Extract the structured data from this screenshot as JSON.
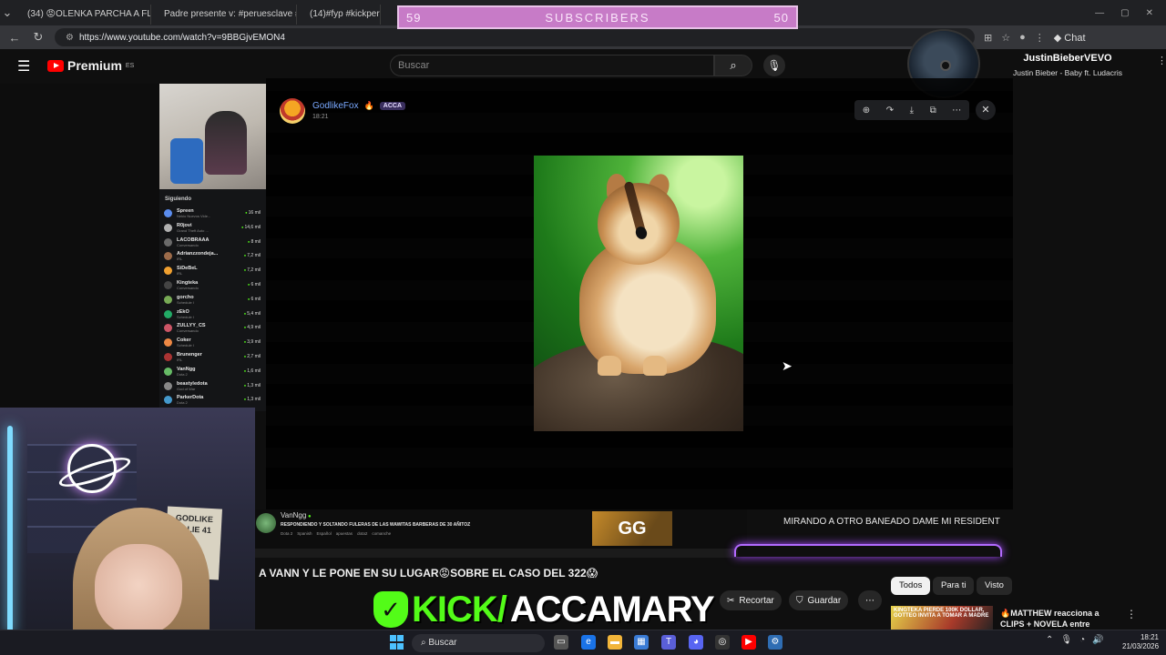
{
  "browser": {
    "tabs": [
      {
        "label": "(34) 😡OLENKA PARCHA A FLAPA",
        "color": "#e53935"
      },
      {
        "label": "Padre presente v: #peruesclave #c",
        "color": "#ffffff"
      },
      {
        "label": "(14)#fyp #kickperu",
        "color": "#ffffff"
      }
    ],
    "url": "https://www.youtube.com/watch?v=9BBGjvEMON4",
    "chat_label": "Chat"
  },
  "youtube": {
    "logo_text": "Premium",
    "region": "ES",
    "search_placeholder": "Buscar",
    "video_title": "A VANN Y LE PONE EN SU LUGAR😡SOBRE EL CASO DEL 322😱",
    "actions": {
      "clip": "Recortar",
      "save": "Guardar"
    },
    "chips": [
      "Todos",
      "Para ti",
      "Visto"
    ],
    "recommendation": {
      "title": "🔥MATTHEW reacciona a CLIPS + NOVELA entre",
      "thumb_text": "KINGTEKA PIERDE 100K DOLLAR, GOTTEO INVITA A TOMAR A MADRE"
    }
  },
  "overlay": {
    "subscribers": {
      "current": "59",
      "label": "SUBSCRIBERS",
      "goal": "50"
    },
    "now_playing": {
      "artist": "JustinBieberVEVO",
      "song": "Justin Bieber - Baby ft. Ludacris"
    },
    "kick_brand": {
      "logo_letter": "✓",
      "left": "KICK/",
      "right": "ACCAMARY"
    },
    "poster_text": "GODLIKE VALIE 41"
  },
  "discord": {
    "user": "GodlikeFox",
    "role_tag": "ACCA",
    "time": "18:21",
    "tools": [
      "zoom-icon",
      "forward-icon",
      "download-icon",
      "open-icon",
      "more-icon"
    ]
  },
  "kick_sidebar": {
    "title": "Siguiendo",
    "items": [
      {
        "name": "Spreen",
        "sub": "Nekio Nuevos Vide...",
        "viewers": "16 mil",
        "color": "#5b8def"
      },
      {
        "name": "R0jovi",
        "sub": "Grand Theft Auto ...",
        "viewers": "14,6 mil",
        "color": "#b0b0b0"
      },
      {
        "name": "LACOBRAAA",
        "sub": "Conversando",
        "viewers": "8 mil",
        "color": "#6a6a6a"
      },
      {
        "name": "Adrianzzondeja...",
        "sub": "IRL",
        "viewers": "7,2 mil",
        "color": "#9c6b4a"
      },
      {
        "name": "SiDeBeL",
        "sub": "IRL",
        "viewers": "7,2 mil",
        "color": "#f0a030"
      },
      {
        "name": "Kingteka",
        "sub": "Conversando",
        "viewers": "6 mil",
        "color": "#444"
      },
      {
        "name": "gorcho",
        "sub": "Schedule I",
        "viewers": "6 mil",
        "color": "#7a5"
      },
      {
        "name": "zEkO",
        "sub": "Schedule I",
        "viewers": "5,4 mil",
        "color": "#2a6"
      },
      {
        "name": "ZULLYY_CS",
        "sub": "Conversando",
        "viewers": "4,9 mil",
        "color": "#c56"
      },
      {
        "name": "Coker",
        "sub": "Schedule I",
        "viewers": "3,9 mil",
        "color": "#e84"
      },
      {
        "name": "Brunenger",
        "sub": "IRL",
        "viewers": "2,7 mil",
        "color": "#a33"
      },
      {
        "name": "VanNgg",
        "sub": "Dota 2",
        "viewers": "1,6 mil",
        "color": "#6b6"
      },
      {
        "name": "beastyledota",
        "sub": "God of War",
        "viewers": "1,3 mil",
        "color": "#888"
      },
      {
        "name": "ParkerDota",
        "sub": "Dota 2",
        "viewers": "1,3 mil",
        "color": "#49c"
      }
    ]
  },
  "stream_info": {
    "channel": "VanNgg",
    "title": "RESPONDIENDO Y SOLTANDO FULERAS DE LAS WAWITAS BARBERAS DE 30 AÑITOZ",
    "tags": [
      "Dota 2",
      "Spanish",
      "Español",
      "apuestas",
      "dota2",
      "comanche"
    ],
    "thumb_text": "GG"
  },
  "chat_message": "MIRANDO A OTRO BANEADO DAME MI RESIDENT",
  "taskbar": {
    "search": "Buscar",
    "time": "18:21",
    "date": "21/03/2026"
  }
}
